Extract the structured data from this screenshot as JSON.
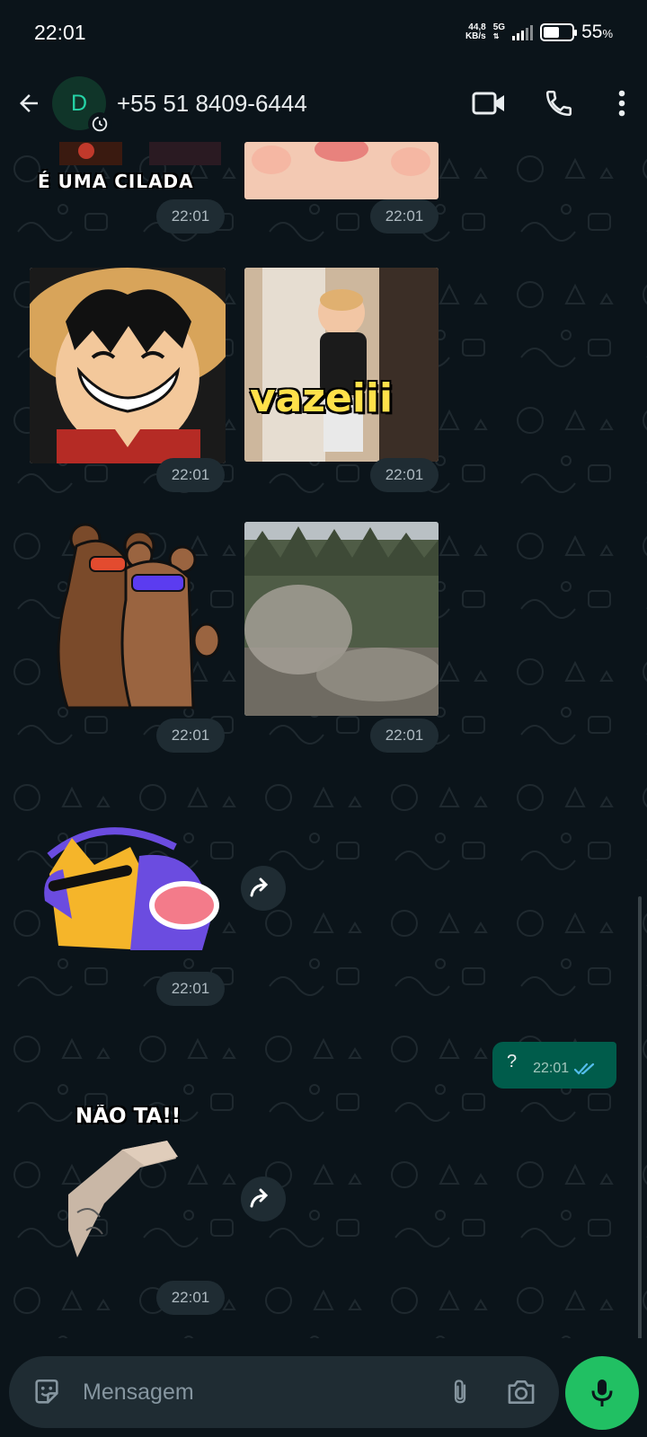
{
  "status_bar": {
    "time": "22:01",
    "net_speed_value": "44,8",
    "net_speed_unit": "KB/s",
    "network_type": "5G",
    "battery_percent": "55",
    "battery_symbol": "%",
    "battery_level": 0.55
  },
  "header": {
    "avatar_initial": "D",
    "contact_name": "+55 51 8409-6444",
    "icons": [
      "back-arrow-icon",
      "disappearing-timer-icon",
      "video-call-icon",
      "voice-call-icon",
      "more-options-icon"
    ]
  },
  "messages": {
    "sticker_1_caption": "É UMA CILADA",
    "sticker_vazeiii_caption": "vazeiii",
    "sticker_naota_caption": "NÃO TA!!",
    "time_row1_left": "22:01",
    "time_row1_right": "22:01",
    "time_row2_left": "22:01",
    "time_row2_right": "22:01",
    "time_row3_left": "22:01",
    "time_row3_right": "22:01",
    "time_cat_sticker": "22:01",
    "outgoing_text": "?",
    "outgoing_time": "22:01",
    "time_hand_sticker": "22:01"
  },
  "composer": {
    "placeholder": "Mensagem"
  },
  "colors": {
    "background": "#0b141a",
    "bubble_chip": "#1f2c33",
    "outgoing_bubble": "#005c4b",
    "accent_green": "#21c063",
    "read_ticks": "#53bdeb"
  }
}
